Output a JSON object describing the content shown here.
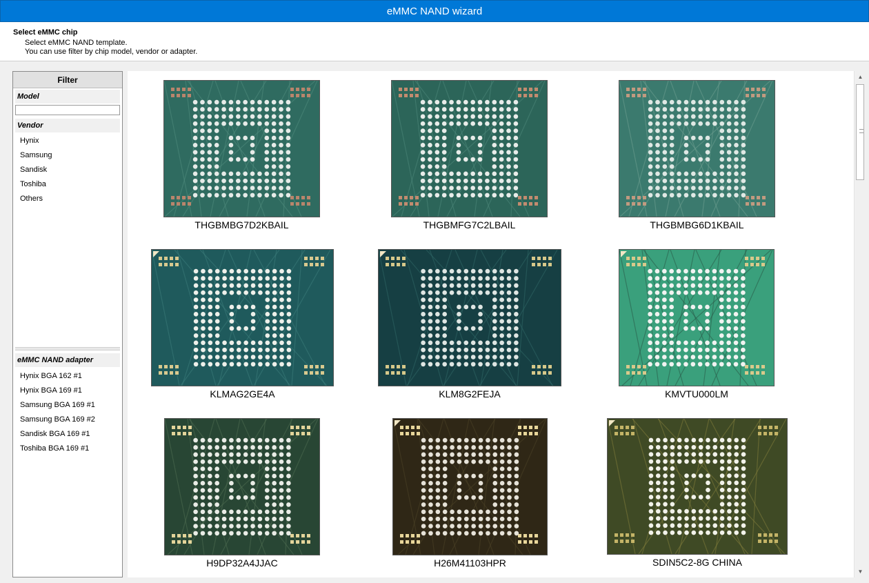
{
  "window": {
    "title": "eMMC NAND wizard"
  },
  "header": {
    "title": "Select eMMC chip",
    "line1": "Select eMMC NAND template.",
    "line2": "You can use filter by chip model, vendor or adapter."
  },
  "filter": {
    "title": "Filter",
    "model_label": "Model",
    "model_value": "",
    "vendor_label": "Vendor",
    "vendors": [
      "Hynix",
      "Samsung",
      "Sandisk",
      "Toshiba",
      "Others"
    ],
    "adapter_label": "eMMC NAND adapter",
    "adapters": [
      "Hynix BGA 162 #1",
      "Hynix BGA 169 #1",
      "Samsung BGA 169 #1",
      "Samsung BGA 169 #2",
      "Sandisk BGA 169 #1",
      "Toshiba BGA 169 #1"
    ]
  },
  "chips": [
    {
      "name": "THGBMBG7D2KBAIL",
      "bg": "#2f6b60",
      "ball": "#e6ebe8",
      "trace": "#4e8a7c",
      "accent": "#b9856c",
      "marker": false
    },
    {
      "name": "THGBMFG7C2LBAIL",
      "bg": "#2c6559",
      "ball": "#e8ece9",
      "trace": "#4b8578",
      "accent": "#c28b6f",
      "marker": false
    },
    {
      "name": "THGBMBG6D1KBAIL",
      "bg": "#3b7a6e",
      "ball": "#dfe8e4",
      "trace": "#6a9c8e",
      "accent": "#c19a80",
      "marker": false
    },
    {
      "name": "KLMAG2GE4A",
      "bg": "#1f5a5c",
      "ball": "#eef0ea",
      "trace": "#3a7b79",
      "accent": "#d8c98f",
      "marker": true
    },
    {
      "name": "KLM8G2FEJA",
      "bg": "#163f43",
      "ball": "#dfe6e3",
      "trace": "#2e6564",
      "accent": "#d6c88a",
      "marker": true
    },
    {
      "name": "KMVTU000LM",
      "bg": "#3aa07c",
      "ball": "#f1f3f1",
      "trace": "#2a5e4b",
      "accent": "#d9c98b",
      "marker": true
    },
    {
      "name": "H9DP32A4JJAC",
      "bg": "#284634",
      "ball": "#e9ece6",
      "trace": "#4b6a4f",
      "accent": "#e3d49a",
      "marker": false
    },
    {
      "name": "H26M41103HPR",
      "bg": "#2f2716",
      "ball": "#e6e2d8",
      "trace": "#4a4126",
      "accent": "#e8d69a",
      "marker": true
    },
    {
      "name": "SDIN5C2-8G CHINA",
      "bg": "#3f4a25",
      "ball": "#f2f2ea",
      "trace": "#7d7a3a",
      "accent": "#c4b467",
      "marker": true
    }
  ]
}
